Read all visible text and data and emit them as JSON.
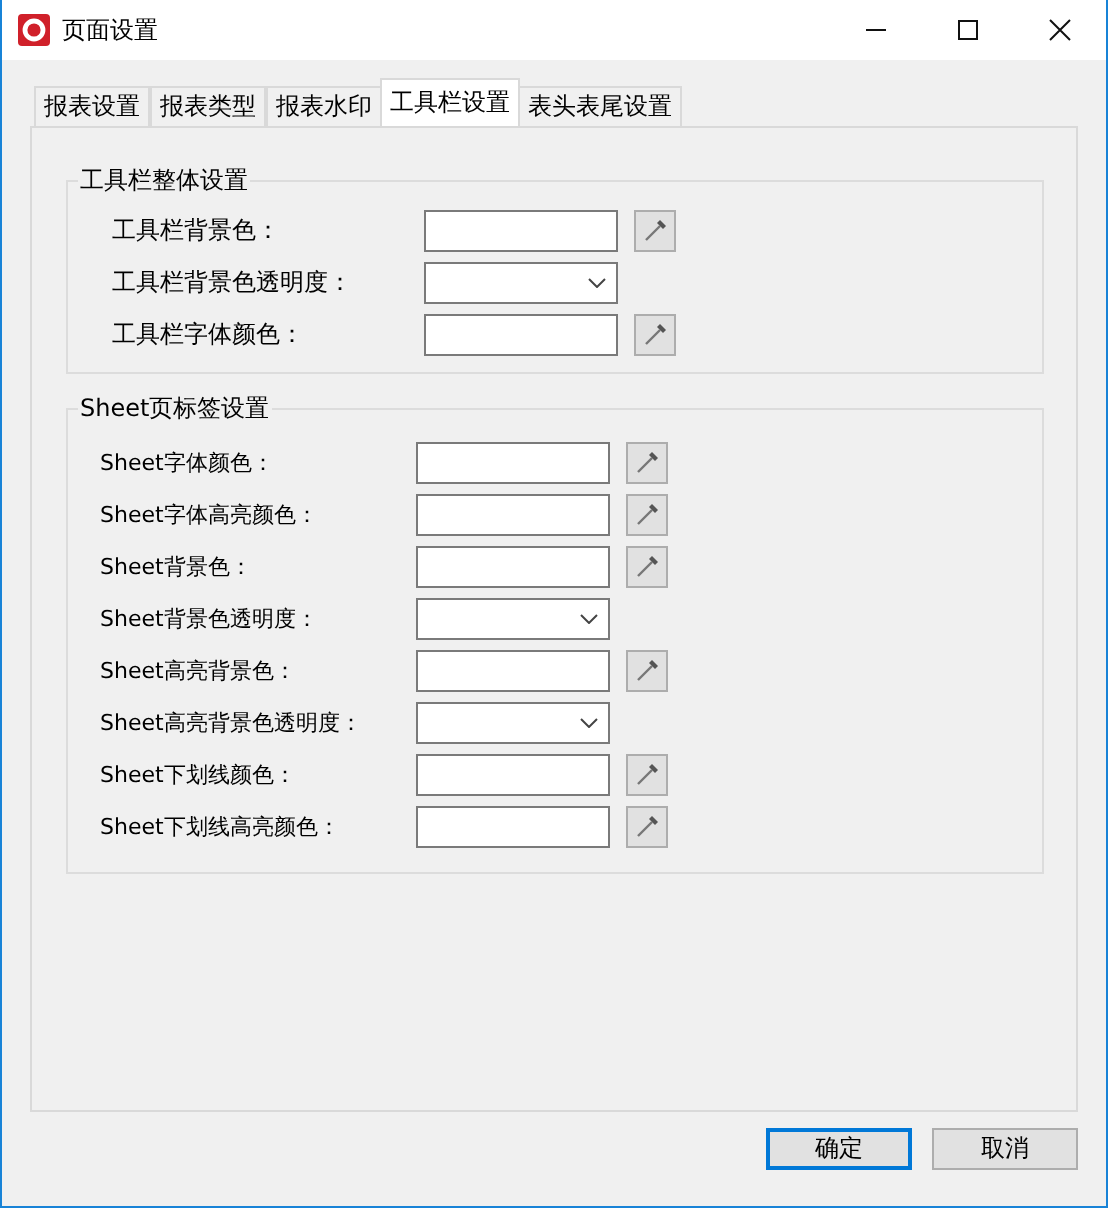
{
  "window": {
    "title": "页面设置"
  },
  "tabs": [
    {
      "label": "报表设置",
      "selected": false
    },
    {
      "label": "报表类型",
      "selected": false
    },
    {
      "label": "报表水印",
      "selected": false
    },
    {
      "label": "工具栏设置",
      "selected": true
    },
    {
      "label": "表头表尾设置",
      "selected": false
    }
  ],
  "groups": [
    {
      "title": "工具栏整体设置",
      "rows": [
        {
          "label": "工具栏背景色：",
          "kind": "color"
        },
        {
          "label": "工具栏背景色透明度：",
          "kind": "dropdown"
        },
        {
          "label": "工具栏字体颜色：",
          "kind": "color"
        }
      ]
    },
    {
      "title": "Sheet页标签设置",
      "rows": [
        {
          "label": "Sheet字体颜色：",
          "kind": "color"
        },
        {
          "label": "Sheet字体高亮颜色：",
          "kind": "color"
        },
        {
          "label": "Sheet背景色：",
          "kind": "color"
        },
        {
          "label": "Sheet背景色透明度：",
          "kind": "dropdown"
        },
        {
          "label": "Sheet高亮背景色：",
          "kind": "color"
        },
        {
          "label": "Sheet高亮背景色透明度：",
          "kind": "dropdown"
        },
        {
          "label": "Sheet下划线颜色：",
          "kind": "color"
        },
        {
          "label": "Sheet下划线高亮颜色：",
          "kind": "color"
        }
      ]
    }
  ],
  "buttons": [
    {
      "label": "确定",
      "kind": "primary"
    },
    {
      "label": "取消",
      "kind": "normal"
    }
  ]
}
